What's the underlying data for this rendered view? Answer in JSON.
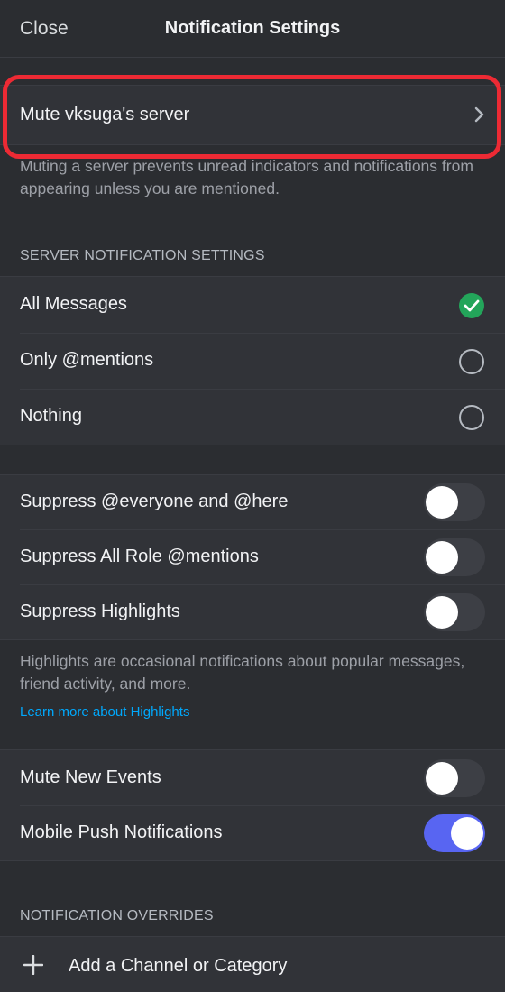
{
  "header": {
    "close_label": "Close",
    "title": "Notification Settings"
  },
  "mute": {
    "label": "Mute vksuga's server",
    "helper": "Muting a server prevents unread indicators and notifications from appearing unless you are mentioned."
  },
  "server_notifications": {
    "section_label": "SERVER NOTIFICATION SETTINGS",
    "options": [
      {
        "label": "All Messages",
        "selected": true
      },
      {
        "label": "Only @mentions",
        "selected": false
      },
      {
        "label": "Nothing",
        "selected": false
      }
    ]
  },
  "suppress": {
    "items": [
      {
        "label": "Suppress @everyone and @here",
        "on": false
      },
      {
        "label": "Suppress All Role @mentions",
        "on": false
      },
      {
        "label": "Suppress Highlights",
        "on": false
      }
    ],
    "helper": "Highlights are occasional notifications about popular messages, friend activity, and more.",
    "link": "Learn more about Highlights"
  },
  "events": {
    "items": [
      {
        "label": "Mute New Events",
        "on": false
      },
      {
        "label": "Mobile Push Notifications",
        "on": true
      }
    ]
  },
  "overrides": {
    "section_label": "NOTIFICATION OVERRIDES",
    "add_label": "Add a Channel or Category"
  },
  "colors": {
    "background": "#2b2d31",
    "row": "#313338",
    "accent": "#5865f2",
    "selected": "#23a55a",
    "highlight_box": "#ed2a34",
    "link": "#00a8fc"
  }
}
